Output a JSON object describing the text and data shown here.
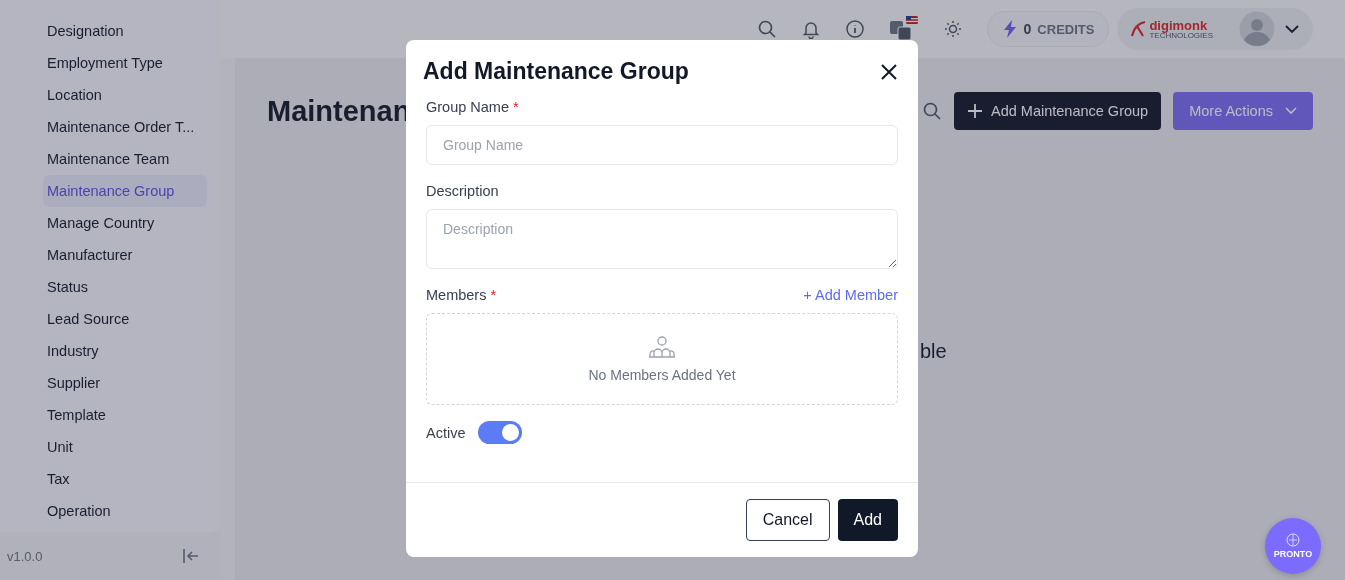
{
  "sidebar": {
    "items": [
      {
        "label": "Designation",
        "selected": false
      },
      {
        "label": "Employment Type",
        "selected": false
      },
      {
        "label": "Location",
        "selected": false
      },
      {
        "label": "Maintenance Order T...",
        "selected": false
      },
      {
        "label": "Maintenance Team",
        "selected": false
      },
      {
        "label": "Maintenance Group",
        "selected": true
      },
      {
        "label": "Manage Country",
        "selected": false
      },
      {
        "label": "Manufacturer",
        "selected": false
      },
      {
        "label": "Status",
        "selected": false
      },
      {
        "label": "Lead Source",
        "selected": false
      },
      {
        "label": "Industry",
        "selected": false
      },
      {
        "label": "Supplier",
        "selected": false
      },
      {
        "label": "Template",
        "selected": false
      },
      {
        "label": "Unit",
        "selected": false
      },
      {
        "label": "Tax",
        "selected": false
      },
      {
        "label": "Operation",
        "selected": false
      }
    ],
    "version": "v1.0.0"
  },
  "header": {
    "credits_count": "0",
    "credits_label": "CREDITS",
    "brand": "digimonk",
    "brand_tagline": "TECHNOLOGIES"
  },
  "page": {
    "title": "Maintenan",
    "add_button": "Add Maintenance Group",
    "more_button": "More Actions",
    "empty_message": "ble"
  },
  "modal": {
    "title": "Add Maintenance Group",
    "fields": [
      {
        "kind": "input",
        "label": "Group Name",
        "required_mark": "*",
        "placeholder": "Group Name"
      },
      {
        "kind": "textarea",
        "label": "Description",
        "placeholder": "Description"
      }
    ],
    "members": {
      "label": "Members",
      "required_mark": "*",
      "add_link": "+ Add Member",
      "empty_text": "No Members Added Yet"
    },
    "active": {
      "label": "Active",
      "on": true
    },
    "buttons": {
      "cancel": "Cancel",
      "add": "Add"
    }
  },
  "assistant": {
    "label": "PRONTO"
  }
}
